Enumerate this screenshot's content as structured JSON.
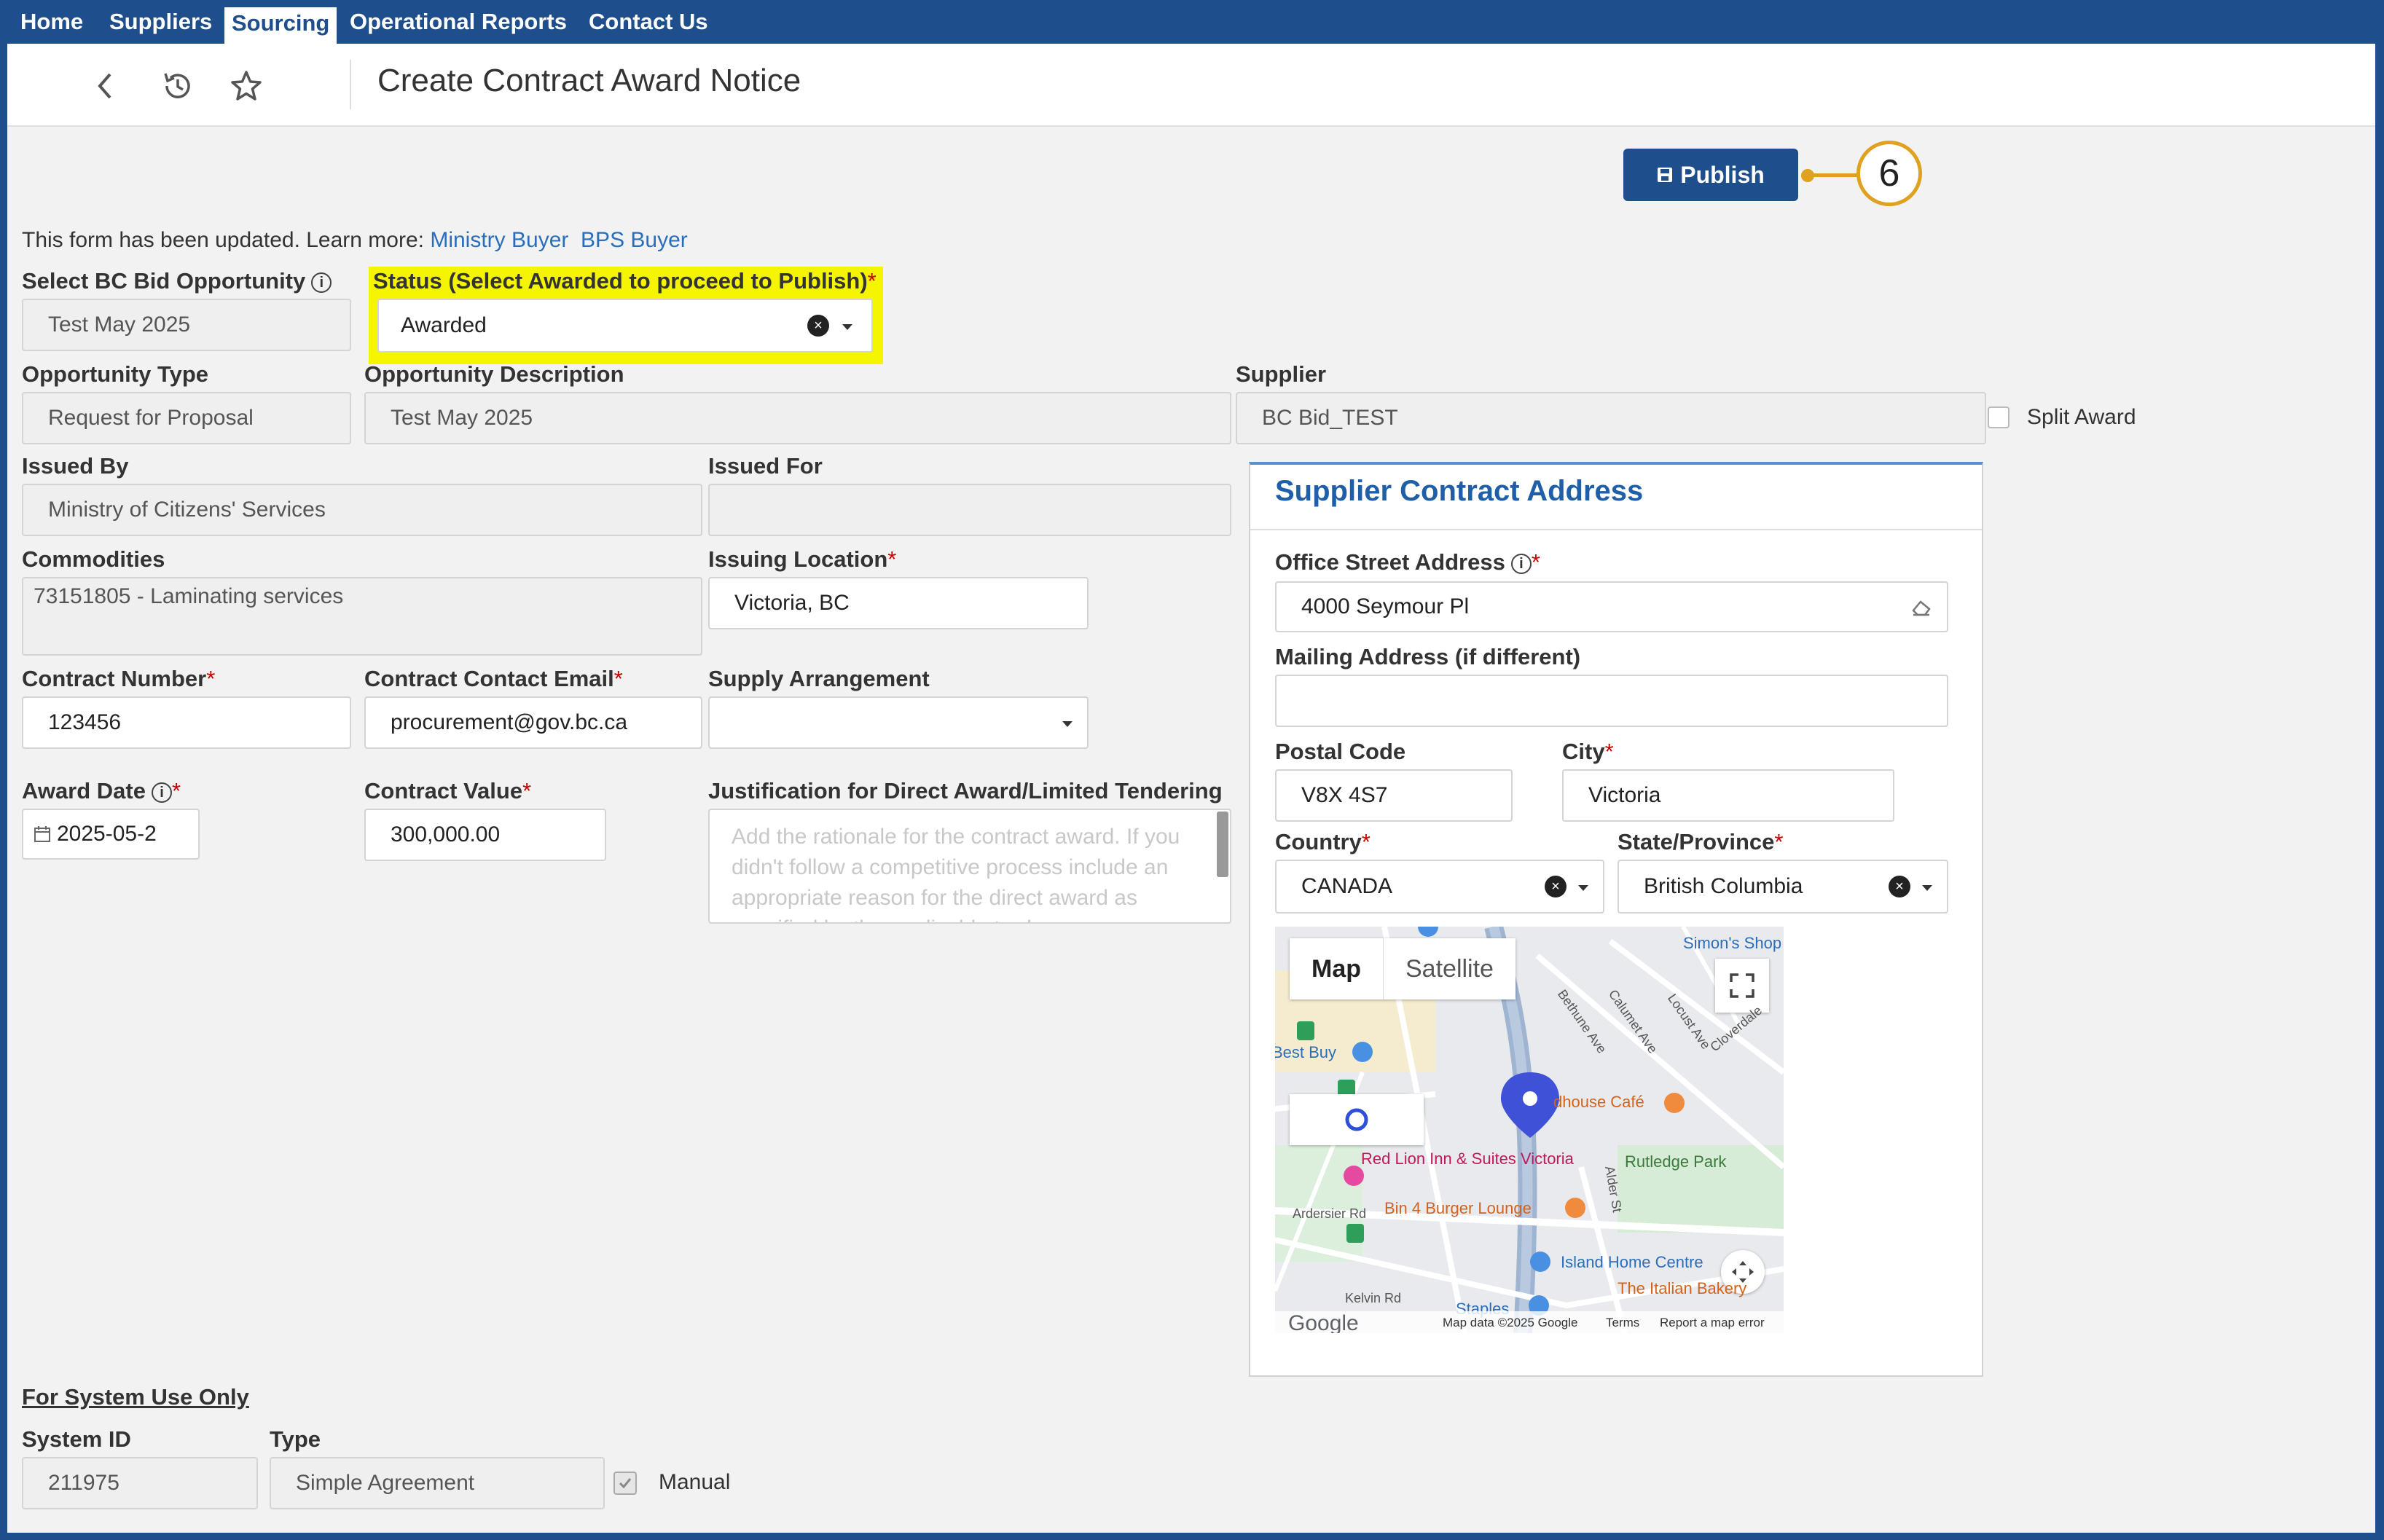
{
  "nav": {
    "items": [
      {
        "label": "Home"
      },
      {
        "label": "Suppliers"
      },
      {
        "label": "Sourcing"
      },
      {
        "label": "Operational Reports"
      },
      {
        "label": "Contact Us"
      }
    ],
    "active": "Sourcing"
  },
  "header": {
    "title": "Create Contract Award Notice"
  },
  "actions": {
    "publish_label": "Publish",
    "callout_number": "6"
  },
  "notice": {
    "text": "This form has been updated. Learn more:",
    "link1": "Ministry Buyer",
    "link2": "BPS Buyer"
  },
  "form": {
    "bid_opportunity": {
      "label": "Select BC Bid Opportunity",
      "value": "Test May 2025"
    },
    "status": {
      "label": "Status (Select Awarded to proceed to Publish)",
      "value": "Awarded"
    },
    "opportunity_type": {
      "label": "Opportunity Type",
      "value": "Request for Proposal"
    },
    "opportunity_description": {
      "label": "Opportunity Description",
      "value": "Test May 2025"
    },
    "supplier": {
      "label": "Supplier",
      "value": "BC Bid_TEST"
    },
    "split_award": {
      "label": "Split Award",
      "checked": false
    },
    "issued_by": {
      "label": "Issued By",
      "value": "Ministry of Citizens' Services"
    },
    "issued_for": {
      "label": "Issued For",
      "value": ""
    },
    "commodities": {
      "label": "Commodities",
      "value": "73151805 - Laminating services"
    },
    "issuing_location": {
      "label": "Issuing Location",
      "value": "Victoria, BC"
    },
    "contract_number": {
      "label": "Contract Number",
      "value": "123456"
    },
    "contract_email": {
      "label": "Contract Contact Email",
      "value": "procurement@gov.bc.ca"
    },
    "supply_arrangement": {
      "label": "Supply Arrangement",
      "value": ""
    },
    "award_date": {
      "label": "Award Date",
      "value": "2025-05-2"
    },
    "contract_value": {
      "label": "Contract Value",
      "value": "300,000.00"
    },
    "justification": {
      "label": "Justification for Direct Award/Limited Tendering",
      "placeholder": "Add the rationale for the contract award. If you didn't follow a competitive process include an appropriate reason for the direct award as specified by the applicable trade"
    }
  },
  "supplier_address": {
    "title": "Supplier Contract Address",
    "office_street": {
      "label": "Office Street Address",
      "value": "4000 Seymour Pl"
    },
    "mailing": {
      "label": "Mailing Address (if different)",
      "value": ""
    },
    "postal_code": {
      "label": "Postal Code",
      "value": "V8X 4S7"
    },
    "city": {
      "label": "City",
      "value": "Victoria"
    },
    "country": {
      "label": "Country",
      "value": "CANADA"
    },
    "province": {
      "label": "State/Province",
      "value": "British Columbia"
    }
  },
  "map": {
    "tab_map": "Map",
    "tab_satellite": "Satellite",
    "places": [
      "Red Lion Inn & Suites Victoria",
      "Bin 4 Burger Lounge",
      "Rutledge Park",
      "Island Home Centre",
      "The Italian Bakery",
      "dhouse Café",
      "Best Buy",
      "Staples",
      "Simon's Shop"
    ],
    "streets": [
      "Ardersier Rd",
      "Kelvin Rd",
      "Alder St",
      "Bethune Ave",
      "Calumet Ave",
      "Locust Ave",
      "Cloverdale"
    ],
    "footer": {
      "map_data": "Map data ©2025 Google",
      "terms": "Terms",
      "report": "Report a map error",
      "logo": "Google"
    }
  },
  "system": {
    "heading": "For System Use Only",
    "system_id": {
      "label": "System ID",
      "value": "211975"
    },
    "type": {
      "label": "Type",
      "value": "Simple Agreement"
    },
    "manual": {
      "label": "Manual",
      "checked": true
    }
  },
  "colors": {
    "nav_bg": "#1f4e8c",
    "accent": "#1f5fa8",
    "highlight": "#f5f500",
    "callout": "#e0a020"
  }
}
